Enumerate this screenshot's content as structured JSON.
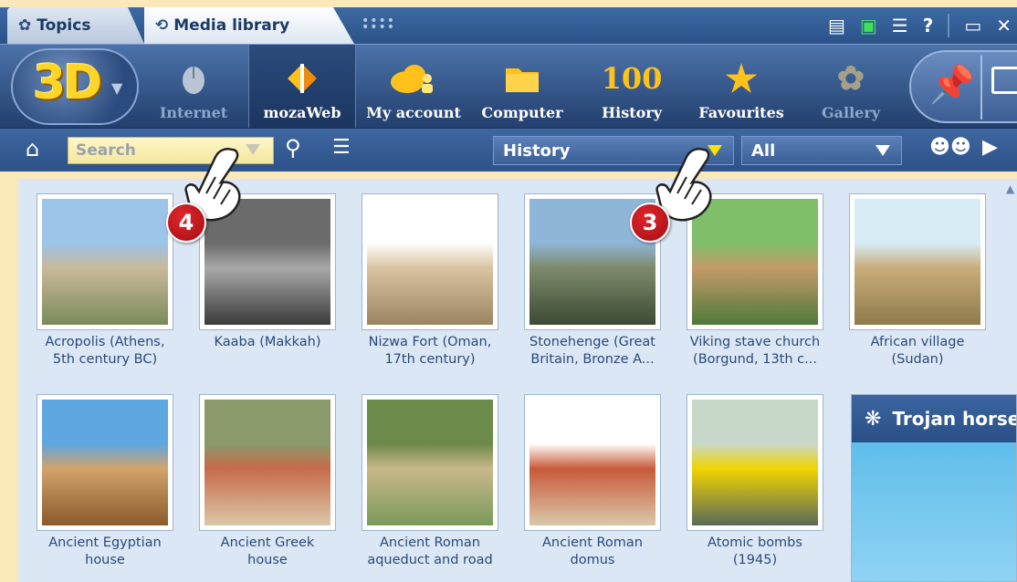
{
  "tabs": [
    {
      "label": "Topics",
      "icon": "topics-icon"
    },
    {
      "label": "Media library",
      "icon": "media-library-icon"
    }
  ],
  "logo": {
    "text": "3D"
  },
  "toolbar": {
    "buttons": [
      {
        "label": "Internet",
        "icon": "mouse-icon",
        "state": "disabled"
      },
      {
        "label": "mozaWeb",
        "icon": "mozaweb-icon",
        "state": "active"
      },
      {
        "label": "My account",
        "icon": "cloud-user-icon",
        "state": "normal"
      },
      {
        "label": "Computer",
        "icon": "folder-icon",
        "state": "normal"
      },
      {
        "label": "History",
        "icon": "history-100-icon",
        "icon_text": "100",
        "state": "normal"
      },
      {
        "label": "Favourites",
        "icon": "star-icon",
        "state": "normal"
      },
      {
        "label": "Gallery",
        "icon": "flower-icon",
        "state": "disabled"
      }
    ]
  },
  "filters": {
    "search_placeholder": "Search",
    "category": "History",
    "subcategory": "All"
  },
  "items": [
    {
      "caption": "Acropolis (Athens,\n5th century BC)",
      "colors": [
        "#9cc3e8",
        "#c9b99a",
        "#7a8a5a"
      ]
    },
    {
      "caption": "Kaaba (Makkah)",
      "colors": [
        "#6b6b6b",
        "#a8a8a8",
        "#3a3a3a"
      ]
    },
    {
      "caption": "Nizwa Fort (Oman,\n17th century)",
      "colors": [
        "#ffffff",
        "#d9c3a0",
        "#9b8462"
      ]
    },
    {
      "caption": "Stonehenge (Great\nBritain, Bronze A...",
      "colors": [
        "#8fb6d8",
        "#7d8a6a",
        "#3c4a34"
      ]
    },
    {
      "caption": "Viking stave church\n(Borgund, 13th c...",
      "colors": [
        "#7fbf6a",
        "#c49a6a",
        "#4f7a3a"
      ]
    },
    {
      "caption": "African village\n(Sudan)",
      "colors": [
        "#d8ecf6",
        "#c9ad7a",
        "#8f7a4a"
      ]
    },
    {
      "caption": "Ancient Egyptian\nhouse",
      "colors": [
        "#5ea7e0",
        "#d3a36a",
        "#8a5a2a"
      ]
    },
    {
      "caption": "Ancient Greek\nhouse",
      "colors": [
        "#8a9a6a",
        "#c86a4a",
        "#d9c8a8"
      ]
    },
    {
      "caption": "Ancient Roman\naqueduct and road",
      "colors": [
        "#6c8a4a",
        "#c9b88a",
        "#7a9a5a"
      ]
    },
    {
      "caption": "Ancient Roman\ndomus",
      "colors": [
        "#ffffff",
        "#c85a3a",
        "#d9c8a8"
      ]
    },
    {
      "caption": "Atomic bombs\n(1945)",
      "colors": [
        "#c8d8c8",
        "#f0d400",
        "#5a6a5a"
      ]
    }
  ],
  "side_panel": {
    "title": "Trojan horse"
  },
  "callouts": [
    {
      "number": "4"
    },
    {
      "number": "3"
    }
  ]
}
